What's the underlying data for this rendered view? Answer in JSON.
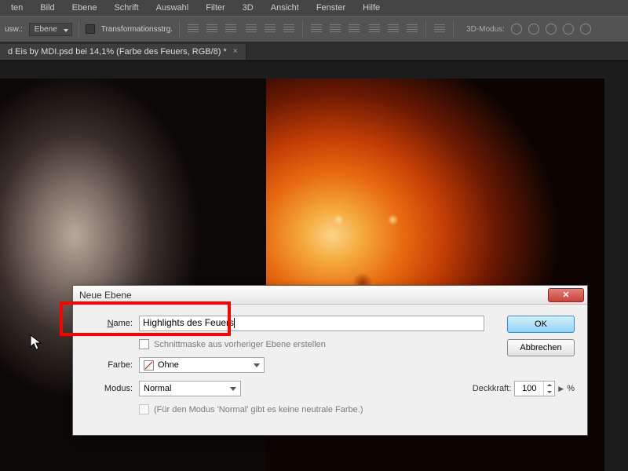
{
  "menu": {
    "items": [
      "ten",
      "Bild",
      "Ebene",
      "Schrift",
      "Auswahl",
      "Filter",
      "3D",
      "Ansicht",
      "Fenster",
      "Hilfe"
    ]
  },
  "options": {
    "left_label": "usw.:",
    "dropdown": "Ebene",
    "checkbox_label": "Transformationsstrg.",
    "mode3d_label": "3D-Modus:"
  },
  "tab": {
    "title": "d Eis by MDI.psd bei 14,1% (Farbe des Feuers, RGB/8) *",
    "close": "×"
  },
  "dialog": {
    "title": "Neue Ebene",
    "name_label": "Name:",
    "name_value": "Highlights des Feuers",
    "clip_mask_label": "Schnittmaske aus vorheriger Ebene erstellen",
    "color_label": "Farbe:",
    "color_value": "Ohne",
    "mode_label": "Modus:",
    "mode_value": "Normal",
    "opacity_label": "Deckkraft:",
    "opacity_value": "100",
    "opacity_suffix": "%",
    "neutral_hint": "(Für den Modus 'Normal' gibt es keine neutrale Farbe.)",
    "ok": "OK",
    "cancel": "Abbrechen"
  }
}
